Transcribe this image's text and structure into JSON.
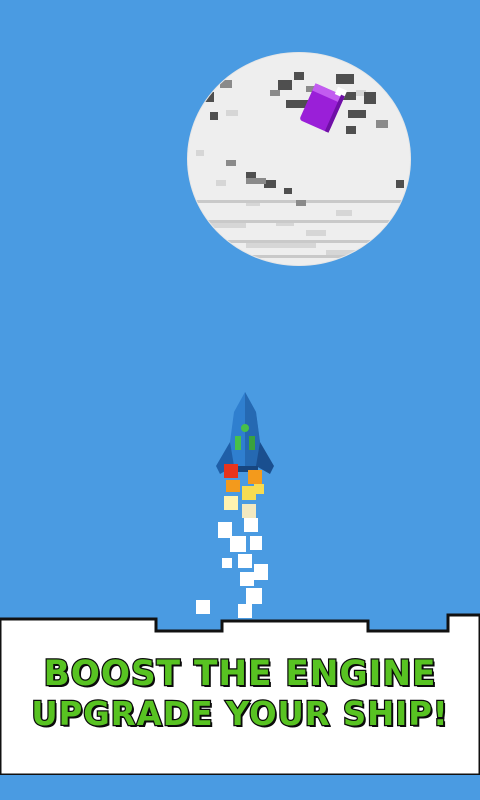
{
  "banner": {
    "line1": "BOOST THE ENGINE",
    "line2": "UPGRADE YOUR SHIP!"
  },
  "colors": {
    "sky": "#4a9be2",
    "moon": "#ececec",
    "moon_shadow": "#cfcfcf",
    "crater": "#5a5a5a",
    "fuel_canister": "#9a1fd8",
    "rocket_body": "#2f7fcf",
    "rocket_fin": "#1f5fa8",
    "rocket_window": "#47c04a",
    "flame_red": "#e8341c",
    "flame_orange": "#f39a1c",
    "flame_yellow": "#f7dc52",
    "smoke": "#ffffff",
    "ground": "#ffffff",
    "text_fill": "#58c322",
    "text_outline": "#0b0b0b"
  },
  "objects": {
    "moon": "pixel-moon",
    "pickup": "fuel-canister",
    "player": "rocket-ship"
  }
}
